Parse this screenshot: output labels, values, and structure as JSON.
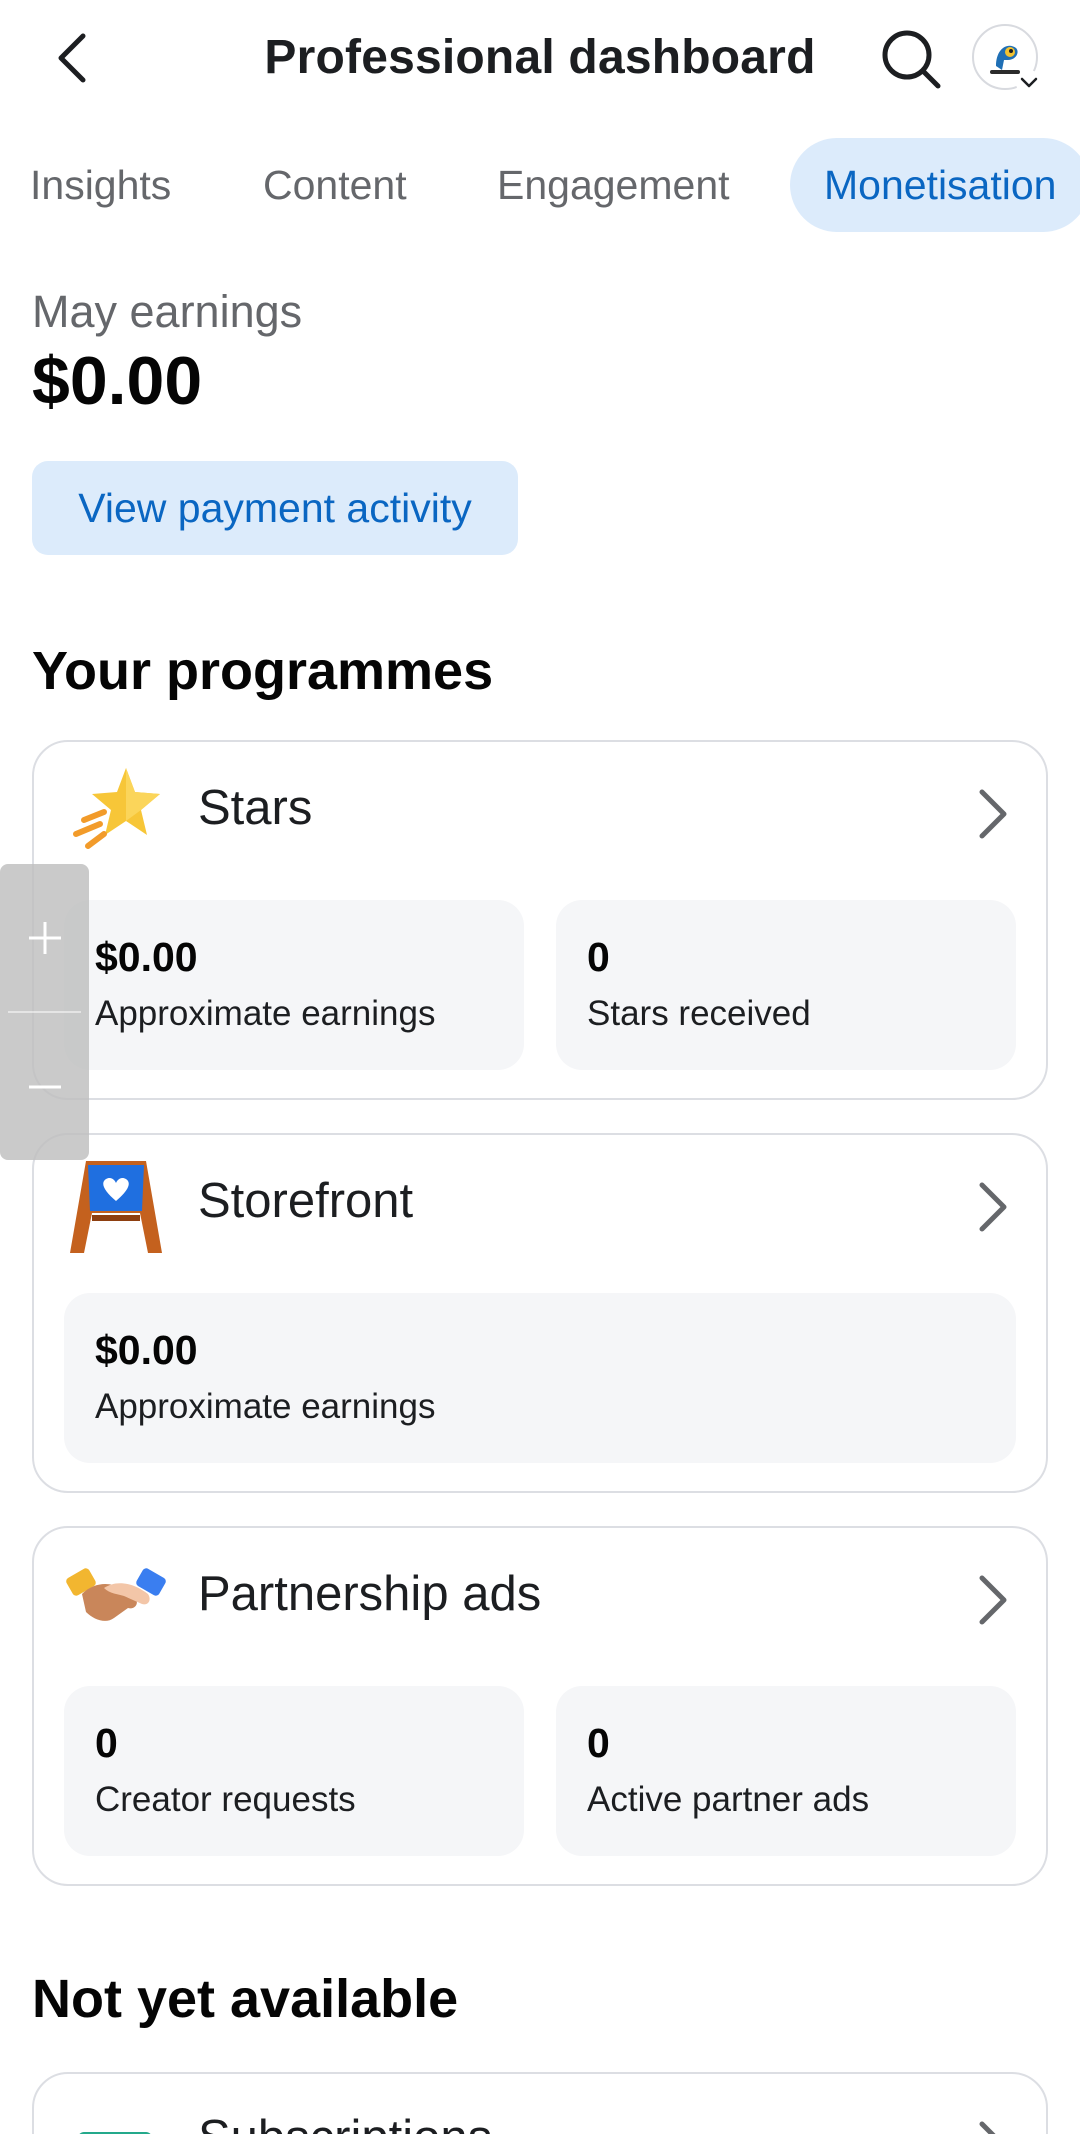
{
  "header": {
    "title": "Professional dashboard",
    "back_icon": "chevron-left-icon",
    "search_icon": "search-icon",
    "avatar_icon": "profile-avatar"
  },
  "tabs": [
    {
      "label": "Insights",
      "active": false
    },
    {
      "label": "Content",
      "active": false
    },
    {
      "label": "Engagement",
      "active": false
    },
    {
      "label": "Monetisation",
      "active": true
    }
  ],
  "earnings": {
    "label": "May earnings",
    "value": "$0.00",
    "payment_button": "View payment activity"
  },
  "programmes": {
    "title": "Your programmes",
    "items": [
      {
        "name": "Stars",
        "icon": "star-icon",
        "stats": [
          {
            "value": "$0.00",
            "label": "Approximate earnings"
          },
          {
            "value": "0",
            "label": "Stars received"
          }
        ]
      },
      {
        "name": "Storefront",
        "icon": "storefront-icon",
        "stats": [
          {
            "value": "$0.00",
            "label": "Approximate earnings"
          }
        ]
      },
      {
        "name": "Partnership ads",
        "icon": "handshake-icon",
        "stats": [
          {
            "value": "0",
            "label": "Creator requests"
          },
          {
            "value": "0",
            "label": "Active partner ads"
          }
        ]
      }
    ]
  },
  "not_available": {
    "title": "Not yet available",
    "items": [
      {
        "name": "Subscriptions",
        "icon": "subscriptions-icon"
      }
    ]
  },
  "zoom_control": {
    "plus_icon": "plus-icon",
    "minus_icon": "minus-icon"
  },
  "colors": {
    "accent": "#0a66c2",
    "accent_bg": "#dcebfb",
    "stat_bg": "#f5f6f8",
    "border": "#dcdee3"
  }
}
